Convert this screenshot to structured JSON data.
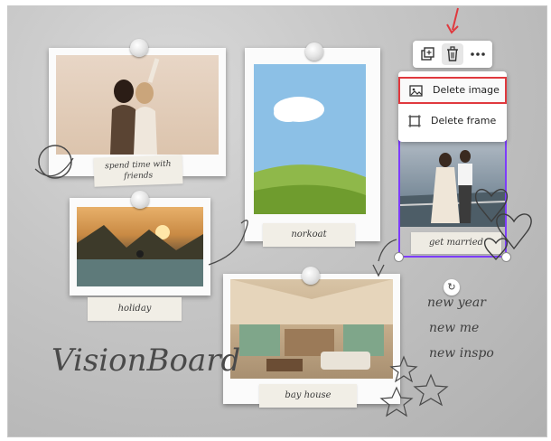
{
  "board": {
    "captions": {
      "friends": "spend time with friends",
      "norkoat": "norkoat",
      "married": "get married",
      "holiday": "holiday",
      "house": "bay house"
    },
    "title": "VisionBoard",
    "slogans": [
      "new year",
      "new me",
      "new inspo"
    ]
  },
  "toolbar": {
    "items": [
      "duplicate-icon",
      "trash-icon",
      "more-icon"
    ]
  },
  "context_menu": {
    "items": [
      {
        "label": "Delete image",
        "icon": "image-icon",
        "highlighted": true
      },
      {
        "label": "Delete frame",
        "icon": "frame-icon",
        "highlighted": false
      }
    ]
  },
  "colors": {
    "selection": "#7d3cff",
    "highlight_border": "#e0393e",
    "arrow": "#e0393e"
  }
}
